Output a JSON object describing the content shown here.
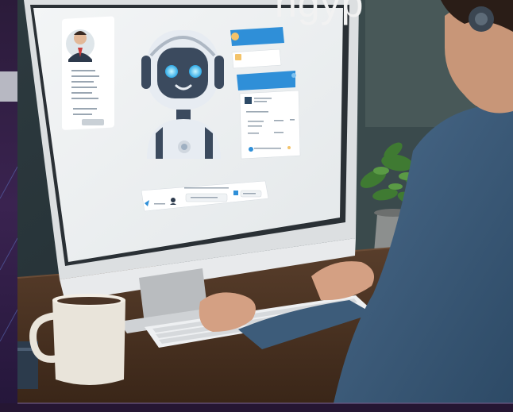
{
  "header": {
    "partial_title": "ngyp"
  },
  "palette": {
    "background": "#1b1226",
    "accent_blue": "#2f8fd8",
    "robot_light": "#e7ecf2",
    "robot_dark": "#3b4a5e"
  }
}
